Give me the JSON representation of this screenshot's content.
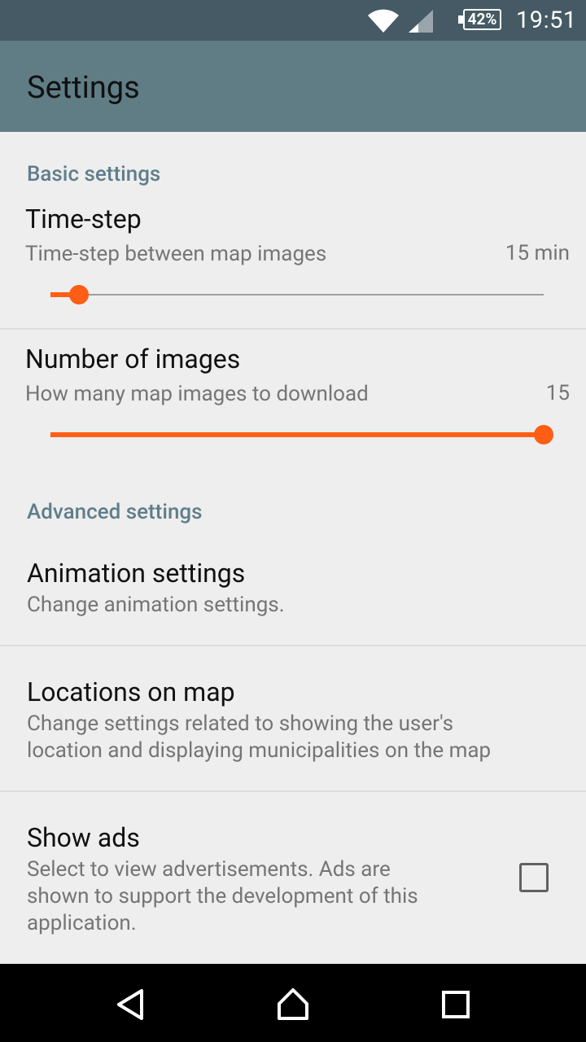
{
  "status_bar": {
    "time": "19:51",
    "battery": "42%",
    "icons": [
      "wifi-icon",
      "cell-signal-icon",
      "battery-icon"
    ]
  },
  "app_bar": {
    "title": "Settings"
  },
  "basic": {
    "header": "Basic settings",
    "time_step": {
      "title": "Time-step",
      "summary": "Time-step between map images",
      "value": "15 min",
      "fraction": 0.058
    },
    "num_images": {
      "title": "Number of images",
      "summary": "How many map images to download",
      "value": "15",
      "fraction": 1.0
    }
  },
  "advanced": {
    "header": "Advanced settings",
    "animation": {
      "title": "Animation settings",
      "summary": "Change animation settings."
    },
    "locations": {
      "title": "Locations on map",
      "summary_line1": "Change settings related to showing the user's",
      "summary_line2": "location and displaying municipalities on the map"
    },
    "ads": {
      "title": "Show ads",
      "summary_line1": "Select to view advertisements. Ads are",
      "summary_line2": "shown to support the development of this",
      "summary_line3": "application.",
      "checked": false
    }
  },
  "nav_bar": {
    "icons": [
      "back-icon",
      "home-icon",
      "recents-icon"
    ]
  },
  "colors": {
    "status_bar": "#455a64",
    "app_bar": "#607d85",
    "accent": "#ff5e14",
    "section_header": "#607d8b"
  }
}
